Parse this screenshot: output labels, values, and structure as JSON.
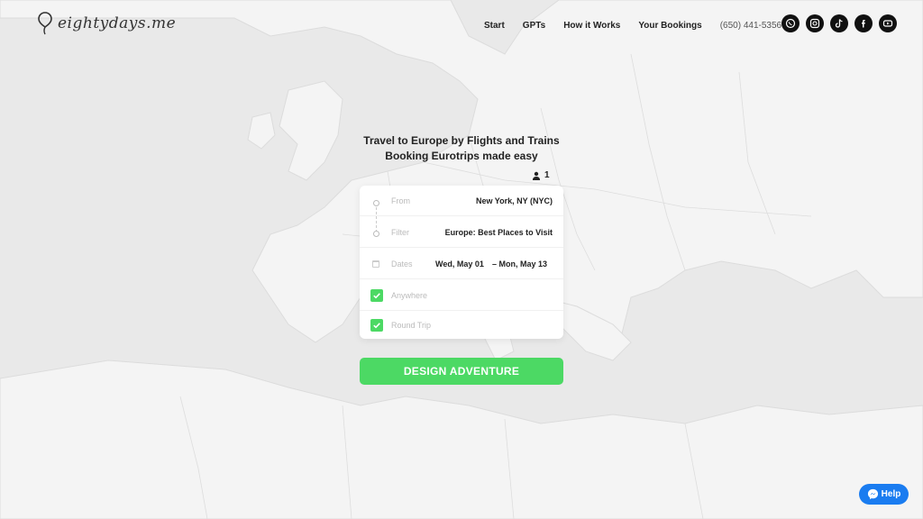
{
  "brand": {
    "name": "eightydays.me"
  },
  "nav": {
    "links": [
      "Start",
      "GPTs",
      "How it Works",
      "Your Bookings"
    ],
    "phone": "(650) 441-5356",
    "socials": [
      "whatsapp-icon",
      "instagram-icon",
      "tiktok-icon",
      "facebook-icon",
      "youtube-icon"
    ]
  },
  "hero": {
    "line1": "Travel to Europe by Flights and Trains",
    "line2": "Booking Eurotrips made easy"
  },
  "travelers": {
    "count": "1"
  },
  "form": {
    "from": {
      "label": "From",
      "value": "New York, NY (NYC)"
    },
    "filter": {
      "label": "Filter",
      "value": "Europe: Best Places to Visit"
    },
    "dates": {
      "label": "Dates",
      "start": "Wed, May 01",
      "end": "– Mon, May 13"
    },
    "anywhere": {
      "label": "Anywhere",
      "checked": true
    },
    "round_trip": {
      "label": "Round Trip",
      "checked": true
    }
  },
  "cta": {
    "label": "DESIGN ADVENTURE"
  },
  "help": {
    "label": "Help"
  },
  "colors": {
    "accent": "#4cd964",
    "help": "#1a7cf0",
    "background": "#ececec"
  }
}
